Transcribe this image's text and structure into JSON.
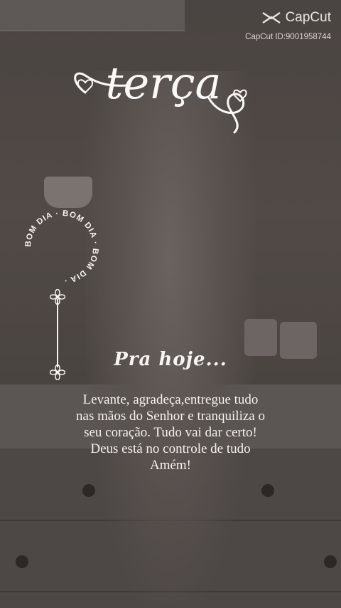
{
  "watermark": {
    "brand": "CapCut",
    "id_text": "CapCut ID:9001958744",
    "icon": "capcut-logo-icon"
  },
  "header": {
    "day": "terça"
  },
  "ring_badge": {
    "text": "BOM DIA · BOM DIA · BOM DIA · "
  },
  "content": {
    "subtitle": "Pra hoje...",
    "lines": [
      "Levante, agradeça,entregue tudo",
      "nas mãos do Senhor e tranquiliza o",
      "seu coração. Tudo vai dar certo!",
      "Deus está no controle de tudo",
      "Amém!"
    ]
  },
  "colors": {
    "text": "#f5f2f0",
    "overlay": "#3b3634"
  }
}
